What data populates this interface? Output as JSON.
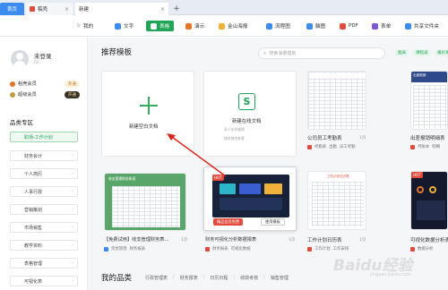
{
  "tabs": {
    "home": "首页",
    "draft": "稿壳",
    "new": "新建"
  },
  "toolbar": {
    "mine": "我的",
    "text": "文字",
    "tables": "表格",
    "slides": "演示",
    "mind": "金山海报",
    "flow": "流程图",
    "brain": "脑图",
    "pdf": "PDF",
    "form": "表单",
    "share": "共享文件夹"
  },
  "user": {
    "name": "未登录",
    "sub": "ID",
    "member1": "稻壳会员",
    "member1_btn": "开通",
    "member2": "超级会员",
    "member2_btn": "开通"
  },
  "sidebar": {
    "section": "品类专区",
    "items": [
      "职场-工作计划",
      "财务会计",
      "个人简历",
      "人事行政",
      "营销策划",
      "市场销售",
      "教学资料",
      "表格管理",
      "可视化表"
    ]
  },
  "main": {
    "heading": "推荐模板",
    "search_placeholder": "搜索海量模板",
    "chips": [
      "图表",
      "课程表",
      "报价单"
    ],
    "blank_doc": "新建空白文档",
    "online_doc": "新建在线文档",
    "online_sub1": "多人协作编辑",
    "online_sub2": "随时随地查看",
    "cards": [
      {
        "title": "公司员工考勤表",
        "count": "1页",
        "tags": [
          "考勤表",
          "出勤",
          "员工考勤"
        ]
      },
      {
        "title": "出差报销明细表",
        "count": "1页",
        "tags": [
          "月账本",
          "明细"
        ]
      },
      {
        "title": "【免费试用】收支管理财务表...",
        "count": "1页",
        "tags": [
          "资金管理",
          "财务报表"
        ]
      },
      {
        "title": "财务可视化分析数据报表",
        "count": "1页",
        "tags": [
          "财务报表",
          "可视化数据"
        ]
      },
      {
        "title": "工作计划日历表",
        "count": "1页",
        "tags": [
          "工作计划",
          "工作安排"
        ]
      },
      {
        "title": "可视化数据分析表",
        "count": "1页",
        "tags": [
          "数据分析"
        ]
      }
    ],
    "card4_badge": "精品会员免费",
    "card4_use": "使用模板",
    "card3_header": "收支管理财务账表",
    "card6_header": "工作计划日历表",
    "card2_header": "出差报销",
    "my_categories": "我的品类",
    "cat_links": [
      "行政管理表",
      "财务报表",
      "日历日程",
      "绩效考核",
      "销售管理"
    ]
  },
  "watermark": "Baidu经验",
  "watermark_url": "jingyan.baidu.com",
  "colors": {
    "accent": "#20a457",
    "blue": "#3c8cf0",
    "red": "#e24a3b"
  }
}
